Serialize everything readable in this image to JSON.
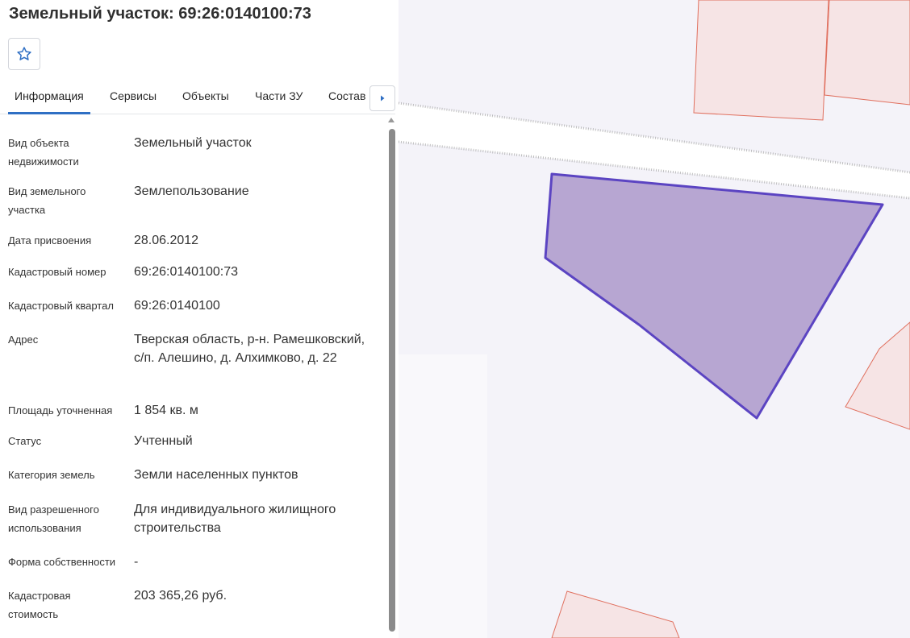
{
  "header": {
    "title": "Земельный участок: 69:26:0140100:73"
  },
  "colors": {
    "accent": "#2f6fc4",
    "parcel_fill": "#b7a6d2",
    "parcel_stroke": "#5b44c2",
    "neighbor_fill": "#f6e4e5",
    "neighbor_stroke": "#e0705f"
  },
  "toolbar": {
    "favorite_icon": "star-icon"
  },
  "tabs": [
    {
      "label": "Информация",
      "active": true
    },
    {
      "label": "Сервисы"
    },
    {
      "label": "Объекты"
    },
    {
      "label": "Части ЗУ"
    },
    {
      "label": "Состав"
    }
  ],
  "tabs_next_icon": "caret-right-icon",
  "info": {
    "object_type": {
      "label": "Вид объекта недвижимости",
      "value": "Земельный участок"
    },
    "parcel_type": {
      "label": "Вид земельного участка",
      "value": "Землепользование"
    },
    "assign_date": {
      "label": "Дата присвоения",
      "value": "28.06.2012"
    },
    "cadastral_number": {
      "label": "Кадастровый номер",
      "value": "69:26:0140100:73"
    },
    "cadastral_quarter": {
      "label": "Кадастровый квартал",
      "value": "69:26:0140100"
    },
    "address": {
      "label": "Адрес",
      "value": "Тверская область, р-н. Рамешковский, с/п. Алешино, д. Алхимково, д. 22"
    },
    "area": {
      "label": "Площадь уточненная",
      "value": "1 854 кв. м"
    },
    "status": {
      "label": "Статус",
      "value": "Учтенный"
    },
    "land_category": {
      "label": "Категория земель",
      "value": "Земли населенных пунктов"
    },
    "permitted_use": {
      "label": "Вид разрешенного использования",
      "value": "Для индивидуального жилищного строительства"
    },
    "ownership": {
      "label": "Форма собственности",
      "value": "-"
    },
    "cadastral_value": {
      "label": "Кадастровая стоимость",
      "value": "203 365,26 руб."
    }
  }
}
